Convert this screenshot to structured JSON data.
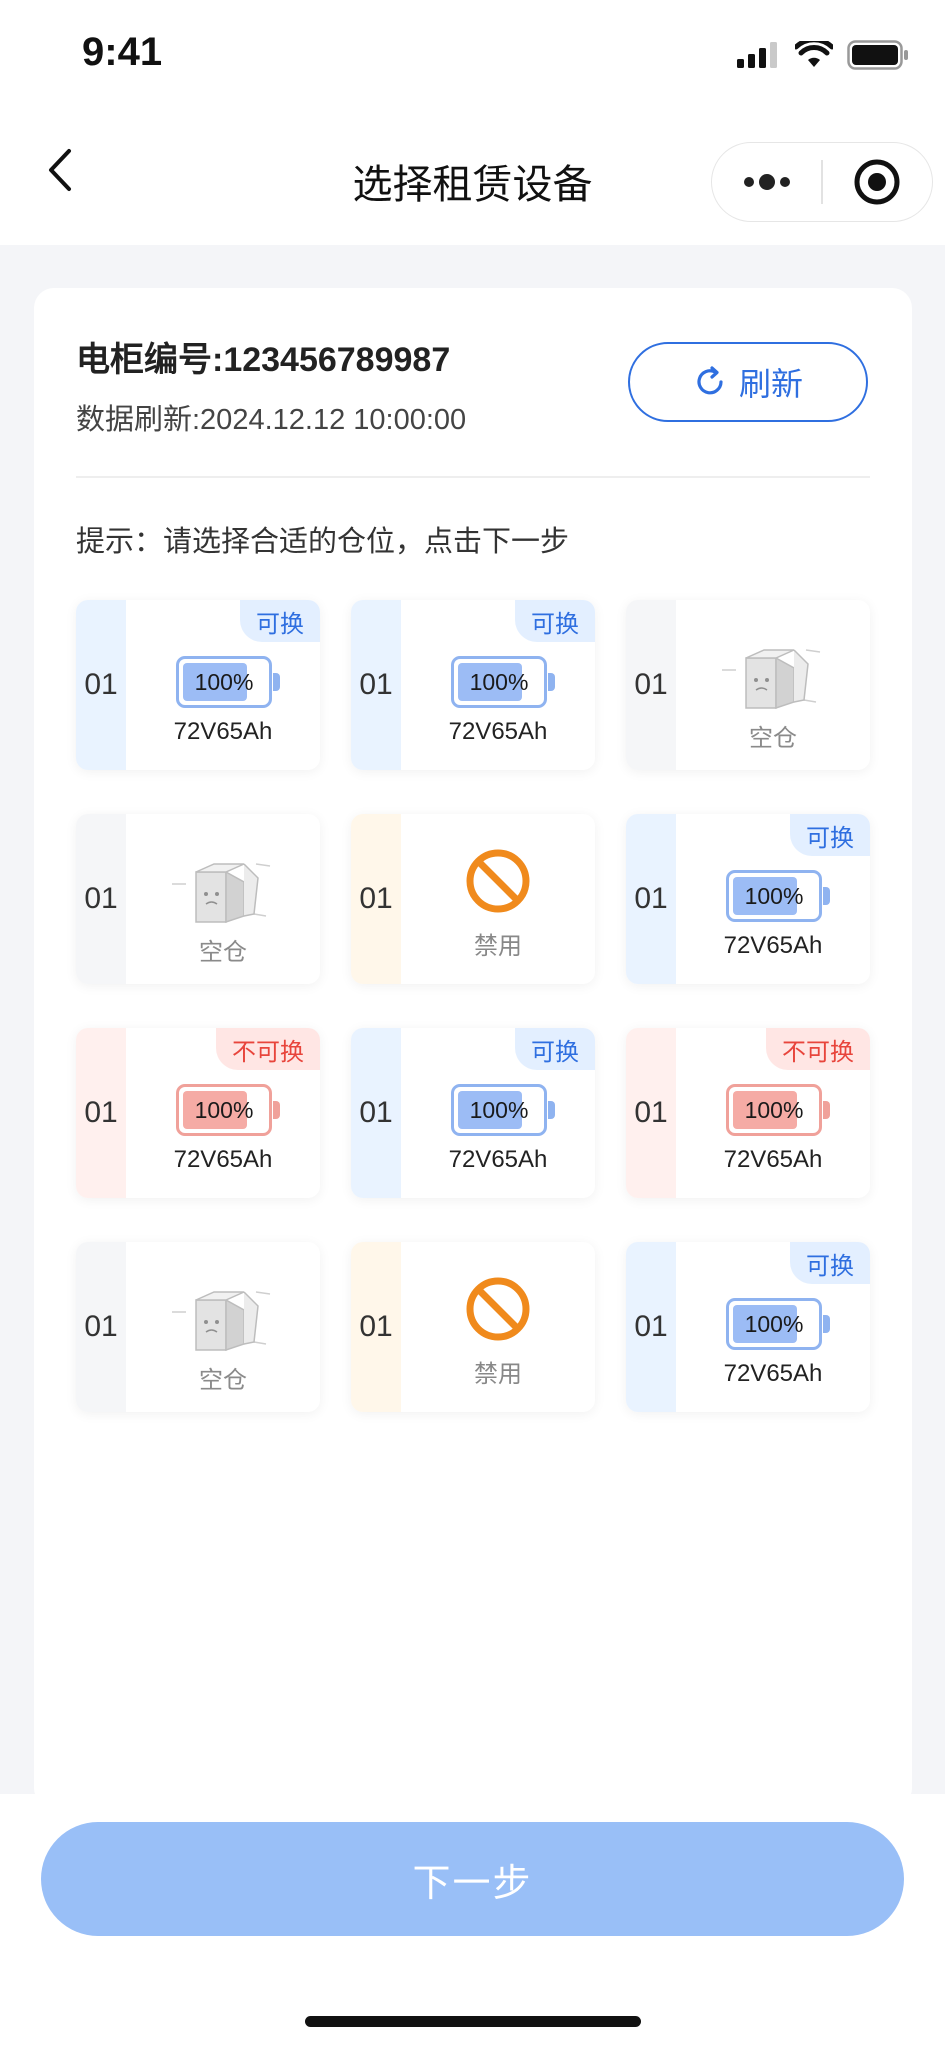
{
  "status_bar": {
    "time": "9:41"
  },
  "nav": {
    "title": "选择租赁设备"
  },
  "cabinet": {
    "number_text": "电柜编号:123456789987",
    "refresh_time_text": "数据刷新:2024.12.12 10:00:00",
    "refresh_label": "刷新"
  },
  "tip": "提示：请选择合适的仓位，点击下一步",
  "colors": {
    "accent": "#2f6fe0",
    "available_tag": "#2f6fe0",
    "unavailable_tag": "#e8453c",
    "disabled_icon": "#f08a1c",
    "next_button": "#99bff7"
  },
  "slots": [
    {
      "no": "01",
      "status": "available",
      "tag": "可换",
      "percent": "100%",
      "charge": 1.0,
      "model": "72V65Ah"
    },
    {
      "no": "01",
      "status": "available",
      "tag": "可换",
      "percent": "100%",
      "charge": 1.0,
      "model": "72V65Ah"
    },
    {
      "no": "01",
      "status": "empty",
      "label": "空仓"
    },
    {
      "no": "01",
      "status": "empty",
      "label": "空仓"
    },
    {
      "no": "01",
      "status": "disabled",
      "label": "禁用"
    },
    {
      "no": "01",
      "status": "available",
      "tag": "可换",
      "percent": "100%",
      "charge": 1.0,
      "model": "72V65Ah"
    },
    {
      "no": "01",
      "status": "unavailable",
      "tag": "不可换",
      "percent": "100%",
      "charge": 1.0,
      "model": "72V65Ah"
    },
    {
      "no": "01",
      "status": "available",
      "tag": "可换",
      "percent": "100%",
      "charge": 1.0,
      "model": "72V65Ah"
    },
    {
      "no": "01",
      "status": "unavailable",
      "tag": "不可换",
      "percent": "100%",
      "charge": 1.0,
      "model": "72V65Ah"
    },
    {
      "no": "01",
      "status": "empty",
      "label": "空仓"
    },
    {
      "no": "01",
      "status": "disabled",
      "label": "禁用"
    },
    {
      "no": "01",
      "status": "available",
      "tag": "可换",
      "percent": "100%",
      "charge": 1.0,
      "model": "72V65Ah"
    }
  ],
  "footer": {
    "next_label": "下一步"
  },
  "icons": {
    "back": "chevron-left-icon",
    "more": "more-dots-icon",
    "close": "target-circle-icon",
    "refresh": "refresh-icon",
    "empty": "empty-box-icon",
    "disabled": "ban-icon",
    "battery": "battery-icon"
  }
}
